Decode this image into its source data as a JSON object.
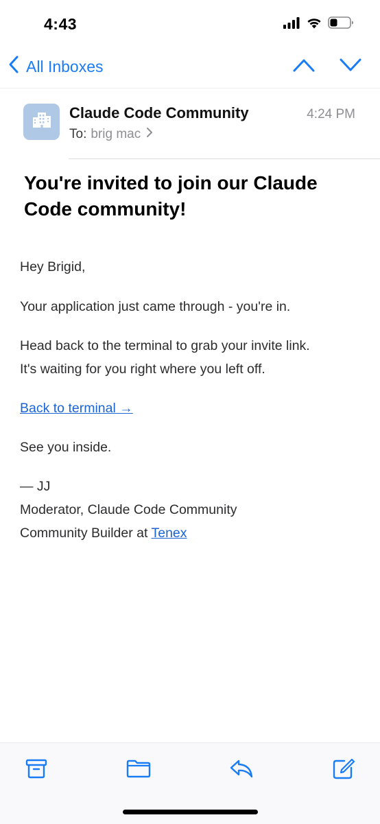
{
  "status_bar": {
    "time": "4:43",
    "icons": [
      "cellular-signal-icon",
      "wifi-icon",
      "battery-icon"
    ]
  },
  "nav": {
    "back_label": "All Inboxes",
    "icons": [
      "chevron-left-icon",
      "chevron-up-icon",
      "chevron-down-icon"
    ]
  },
  "message": {
    "sender": "Claude Code Community",
    "to_label": "To:",
    "recipient": "brig mac",
    "time": "4:24 PM",
    "subject": "You're invited to join our Claude Code community!",
    "body": {
      "greeting": "Hey Brigid,",
      "paragraph_1": "Your application just came through - you're in.",
      "paragraph_2_line_1": "Head back to the terminal to grab your invite link.",
      "paragraph_2_line_2": "It's waiting for you right where you left off.",
      "cta_link": "Back to terminal →",
      "closing": "See you inside.",
      "signature_name": "— JJ",
      "signature_title": "Moderator, Claude Code Community",
      "signature_role_prefix": "Community Builder at ",
      "signature_company_link": "Tenex"
    }
  },
  "toolbar": {
    "icons": [
      "archive-icon",
      "folder-icon",
      "reply-icon",
      "compose-icon"
    ]
  },
  "colors": {
    "accent": "#1a7cf5",
    "link": "#1a64d6",
    "avatar_bg": "#aec8e6",
    "secondary_text": "#8e8e93"
  }
}
